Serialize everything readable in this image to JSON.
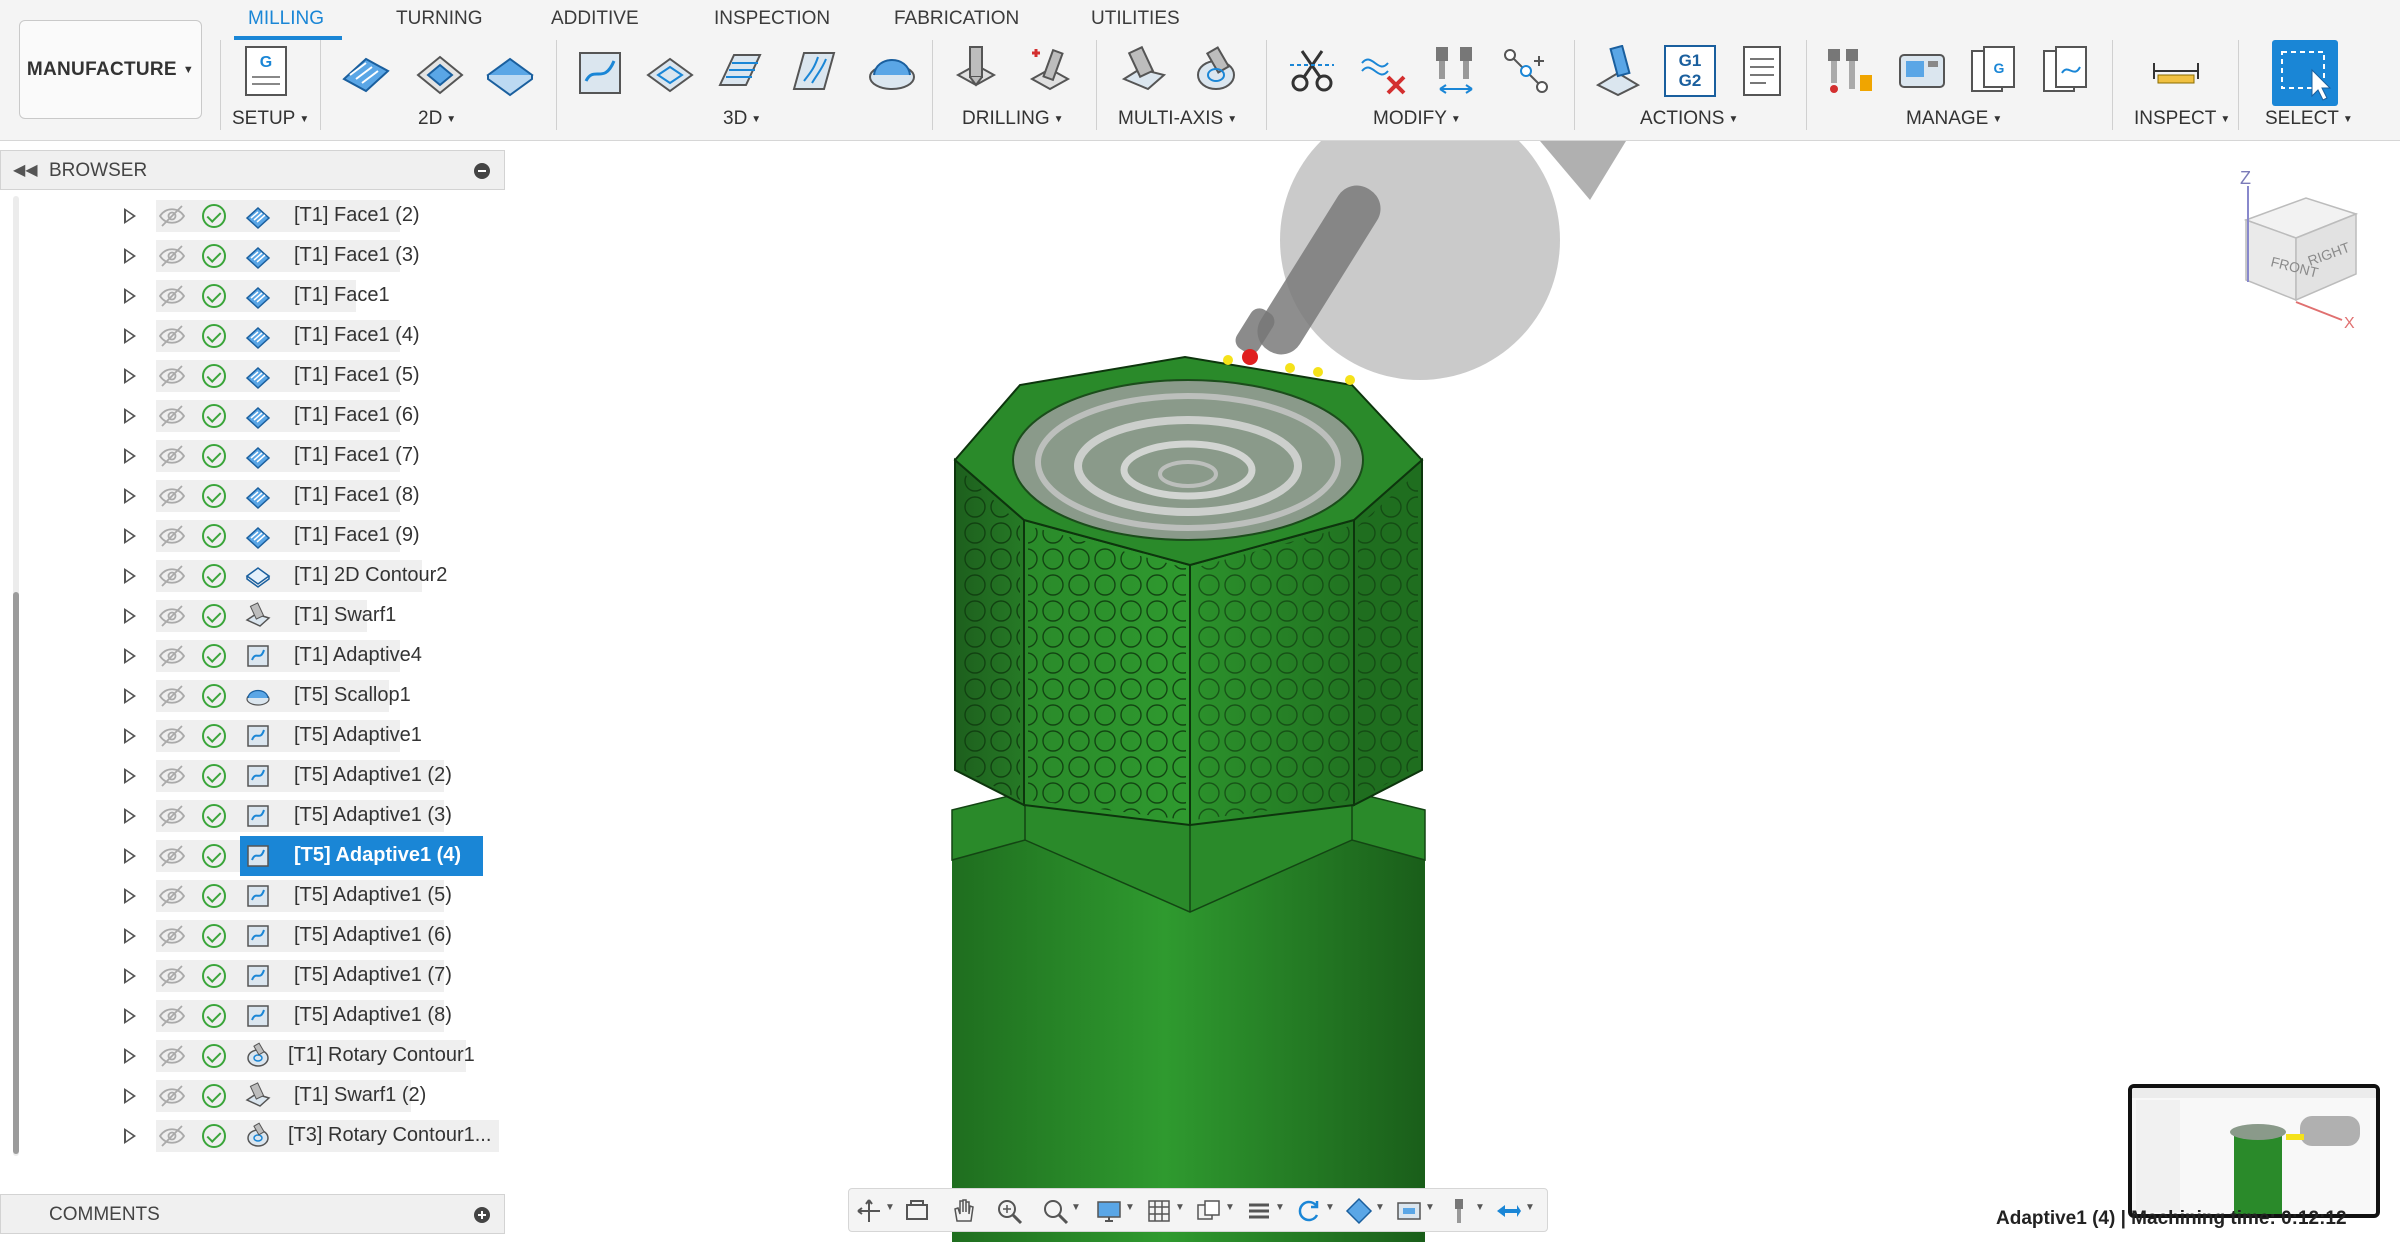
{
  "workspace": {
    "label": "MANUFACTURE"
  },
  "tabs": [
    "MILLING",
    "TURNING",
    "ADDITIVE",
    "INSPECTION",
    "FABRICATION",
    "UTILITIES"
  ],
  "tab_active": "MILLING",
  "tool_groups": [
    "SETUP",
    "2D",
    "3D",
    "DRILLING",
    "MULTI-AXIS",
    "MODIFY",
    "ACTIONS",
    "MANAGE",
    "INSPECT",
    "SELECT"
  ],
  "actions_icon_text": [
    "G1",
    "G2"
  ],
  "setup_icon_text": "G",
  "browser": {
    "title": "BROWSER",
    "items": [
      {
        "label": "[T1] Face1 (2)",
        "icon": "face-icon"
      },
      {
        "label": "[T1] Face1 (3)",
        "icon": "face-icon"
      },
      {
        "label": "[T1] Face1",
        "icon": "face-icon"
      },
      {
        "label": "[T1] Face1 (4)",
        "icon": "face-icon"
      },
      {
        "label": "[T1] Face1 (5)",
        "icon": "face-icon"
      },
      {
        "label": "[T1] Face1 (6)",
        "icon": "face-icon"
      },
      {
        "label": "[T1] Face1 (7)",
        "icon": "face-icon"
      },
      {
        "label": "[T1] Face1 (8)",
        "icon": "face-icon"
      },
      {
        "label": "[T1] Face1 (9)",
        "icon": "face-icon"
      },
      {
        "label": "[T1] 2D Contour2",
        "icon": "contour-icon"
      },
      {
        "label": "[T1] Swarf1",
        "icon": "swarf-icon"
      },
      {
        "label": "[T1] Adaptive4",
        "icon": "adaptive-icon"
      },
      {
        "label": "[T5] Scallop1",
        "icon": "scallop-icon"
      },
      {
        "label": "[T5] Adaptive1",
        "icon": "adaptive-icon"
      },
      {
        "label": "[T5] Adaptive1 (2)",
        "icon": "adaptive-icon"
      },
      {
        "label": "[T5] Adaptive1 (3)",
        "icon": "adaptive-icon"
      },
      {
        "label": "[T5] Adaptive1 (4)",
        "icon": "adaptive-icon",
        "selected": true
      },
      {
        "label": "[T5] Adaptive1 (5)",
        "icon": "adaptive-icon"
      },
      {
        "label": "[T5] Adaptive1 (6)",
        "icon": "adaptive-icon"
      },
      {
        "label": "[T5] Adaptive1 (7)",
        "icon": "adaptive-icon"
      },
      {
        "label": "[T5] Adaptive1 (8)",
        "icon": "adaptive-icon"
      },
      {
        "label": "[T1] Rotary Contour1",
        "icon": "rotary-icon"
      },
      {
        "label": "[T1] Swarf1 (2)",
        "icon": "swarf-icon"
      },
      {
        "label": "[T3] Rotary Contour1...",
        "icon": "rotary-icon"
      }
    ]
  },
  "comments": {
    "title": "COMMENTS"
  },
  "view_cube": {
    "z": "Z",
    "x": "X",
    "front": "FRONT",
    "right": "RIGHT"
  },
  "status": {
    "text": "Adaptive1 (4) | Machining time: 0:12:12"
  },
  "colors": {
    "accent": "#1a86d6",
    "part_green": "#2d8a2d",
    "check_green": "#3aa53a"
  }
}
